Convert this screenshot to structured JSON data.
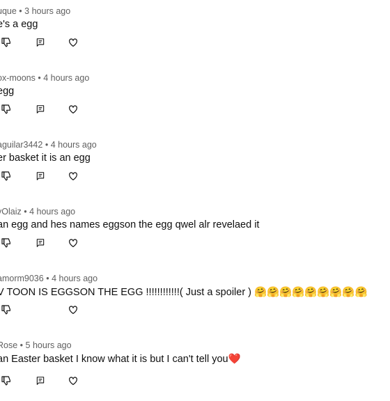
{
  "comments": [
    {
      "author": "uque",
      "time": "3 hours ago",
      "text": "e's a egg"
    },
    {
      "author": "ox-moons",
      "time": "4 hours ago",
      "text": "egg"
    },
    {
      "author": "aguilar3442",
      "time": "4 hours ago",
      "text": "er basket it is an egg"
    },
    {
      "author": "yOlaiz",
      "time": "4 hours ago",
      "text": "an egg and hes names eggson the egg qwel alr revelaed it"
    },
    {
      "author": "amorm9036",
      "time": "4 hours ago",
      "text": "V TOON IS EGGSON THE EGG !!!!!!!!!!!!( Just a spoiler ) 🤗🤗🤗🤗🤗🤗🤗🤗🤗"
    },
    {
      "author": "Rose",
      "time": "5 hours ago",
      "text": "an Easter basket I know what it is but I can't tell you❤️"
    }
  ],
  "separator": "•",
  "icons": {
    "dislike": "thumbs-down-icon",
    "reply": "reply-icon",
    "like": "heart-icon"
  }
}
